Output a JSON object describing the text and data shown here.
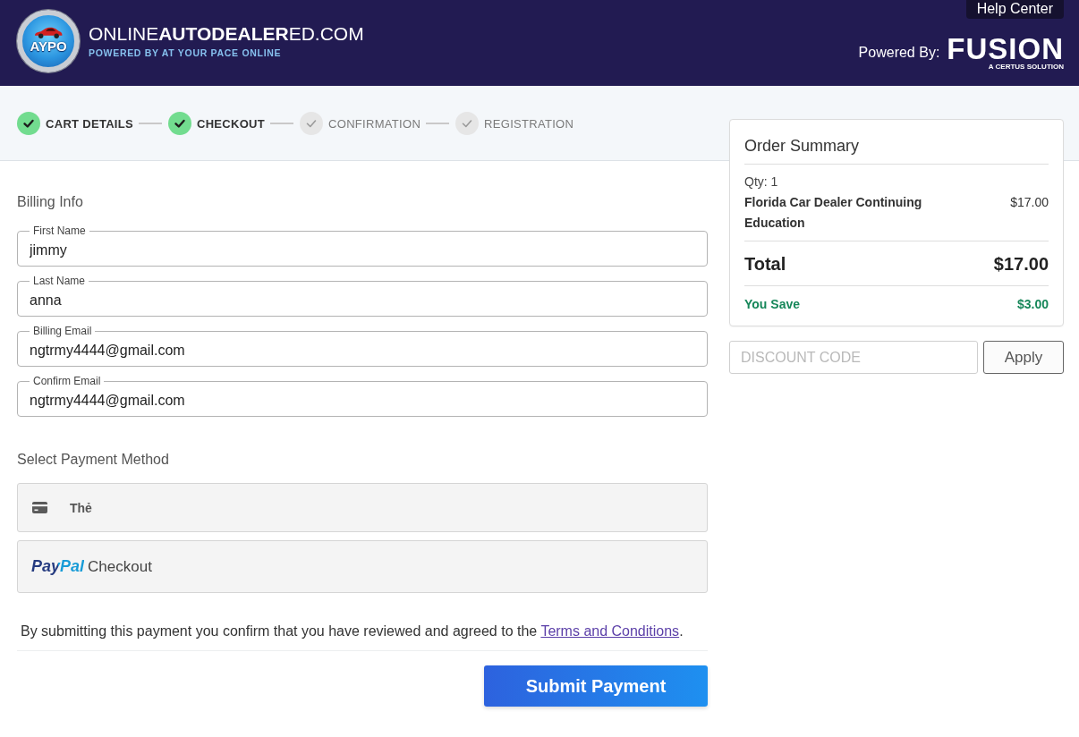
{
  "header": {
    "emblem": "AYPO",
    "brand": "ONLINE**AUTODEALER**ED.COM",
    "tagline": "POWERED BY AT YOUR PACE ONLINE",
    "help_button": "Help Center",
    "powered_by": "Powered By:",
    "partner": {
      "name": "FUSION",
      "subtitle": "A CERTUS SOLUTION"
    }
  },
  "steps": [
    {
      "label": "CART DETAILS",
      "completed": true
    },
    {
      "label": "CHECKOUT",
      "completed": true
    },
    {
      "label": "CONFIRMATION",
      "completed": false
    },
    {
      "label": "REGISTRATION",
      "completed": false
    }
  ],
  "billing": {
    "title": "Billing Info",
    "fields": [
      {
        "label": "First Name",
        "value": "jimmy"
      },
      {
        "label": "Last Name",
        "value": "anna"
      },
      {
        "label": "Billing Email",
        "value": "ngtrmy4444@gmail.com"
      },
      {
        "label": "Confirm Email",
        "value": "ngtrmy4444@gmail.com"
      }
    ]
  },
  "payment": {
    "title": "Select Payment Method",
    "methods": [
      {
        "kind": "card",
        "label": "Thẻ"
      },
      {
        "kind": "paypal",
        "logo": "PayPal",
        "label": "Checkout"
      }
    ]
  },
  "consent": {
    "text": "By submitting this payment you confirm that you have reviewed and agreed to the",
    "link": "Terms and Conditions",
    "end": "."
  },
  "submit_button": "Submit Payment",
  "order_summary": {
    "title": "Order Summary",
    "quantity": "Qty: 1",
    "items": [
      {
        "name": "Florida Car Dealer Continuing Education",
        "price": "$17.00"
      }
    ],
    "total": {
      "label": "Total",
      "amount": "$17.00"
    },
    "savings": {
      "label": "You Save",
      "amount": "$3.00"
    }
  },
  "discount": {
    "placeholder": "DISCOUNT CODE",
    "button": "Apply"
  }
}
